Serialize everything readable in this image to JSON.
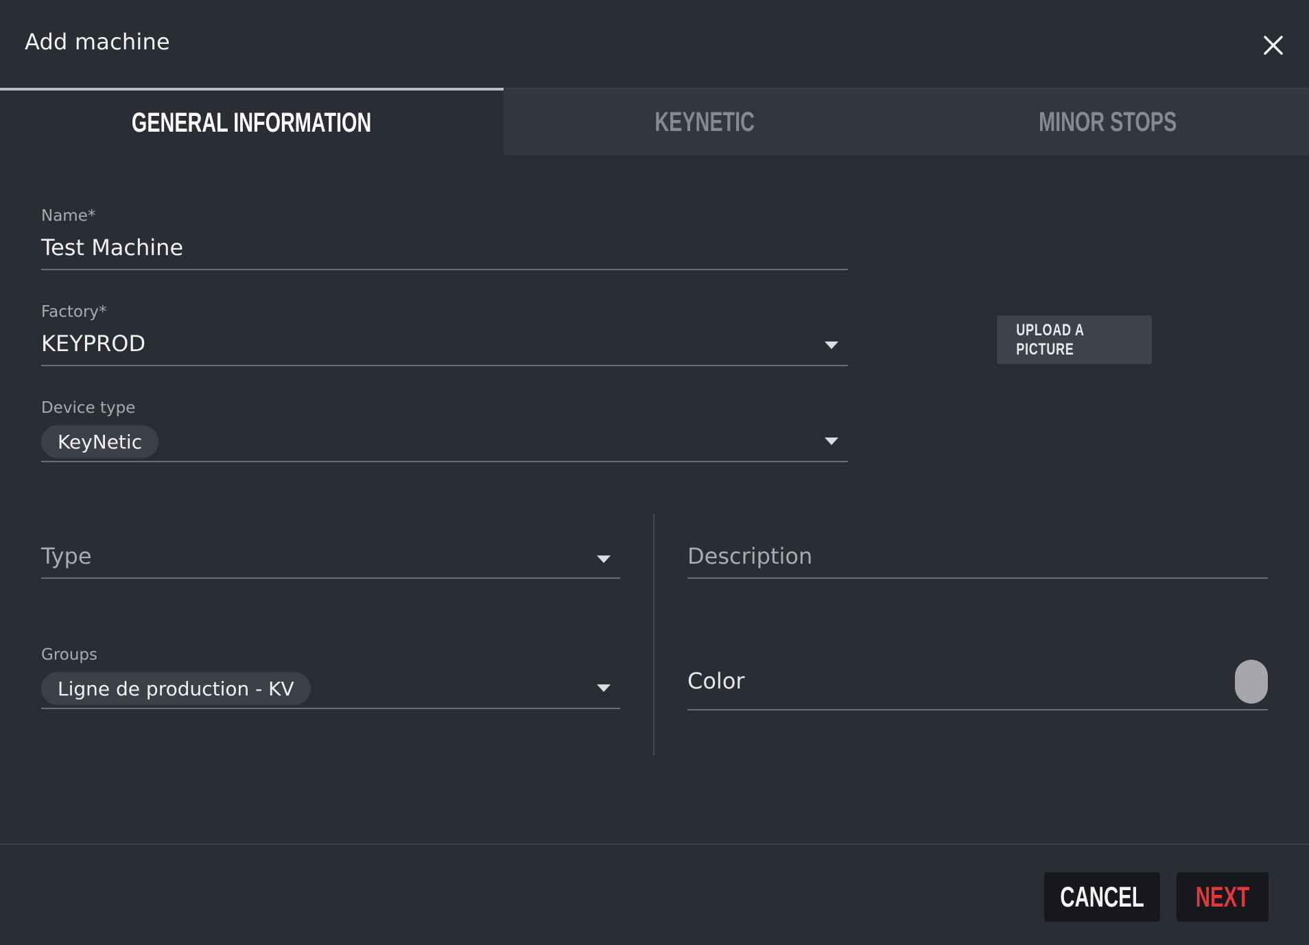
{
  "dialog": {
    "title": "Add machine",
    "close_icon": "close-icon"
  },
  "tabs": [
    {
      "label": "GENERAL INFORMATION",
      "active": true
    },
    {
      "label": "KEYNETIC",
      "active": false
    },
    {
      "label": "MINOR STOPS",
      "active": false
    }
  ],
  "form": {
    "name": {
      "label": "Name*",
      "value": "Test Machine"
    },
    "factory": {
      "label": "Factory*",
      "value": "KEYPROD"
    },
    "device_type": {
      "label": "Device type",
      "value": "KeyNetic"
    },
    "type": {
      "placeholder": "Type"
    },
    "description": {
      "placeholder": "Description"
    },
    "groups": {
      "label": "Groups",
      "value": "Ligne de production - KV"
    },
    "color": {
      "label": "Color",
      "swatch": "#a5a7ab"
    }
  },
  "upload": {
    "label": "UPLOAD A PICTURE"
  },
  "footer": {
    "cancel_label": "CANCEL",
    "next_label": "NEXT",
    "next_color": "#e0383b"
  },
  "colors": {
    "background": "#2a2d33",
    "inactive_tab": "#33363c",
    "button_dark": "#16181b"
  }
}
